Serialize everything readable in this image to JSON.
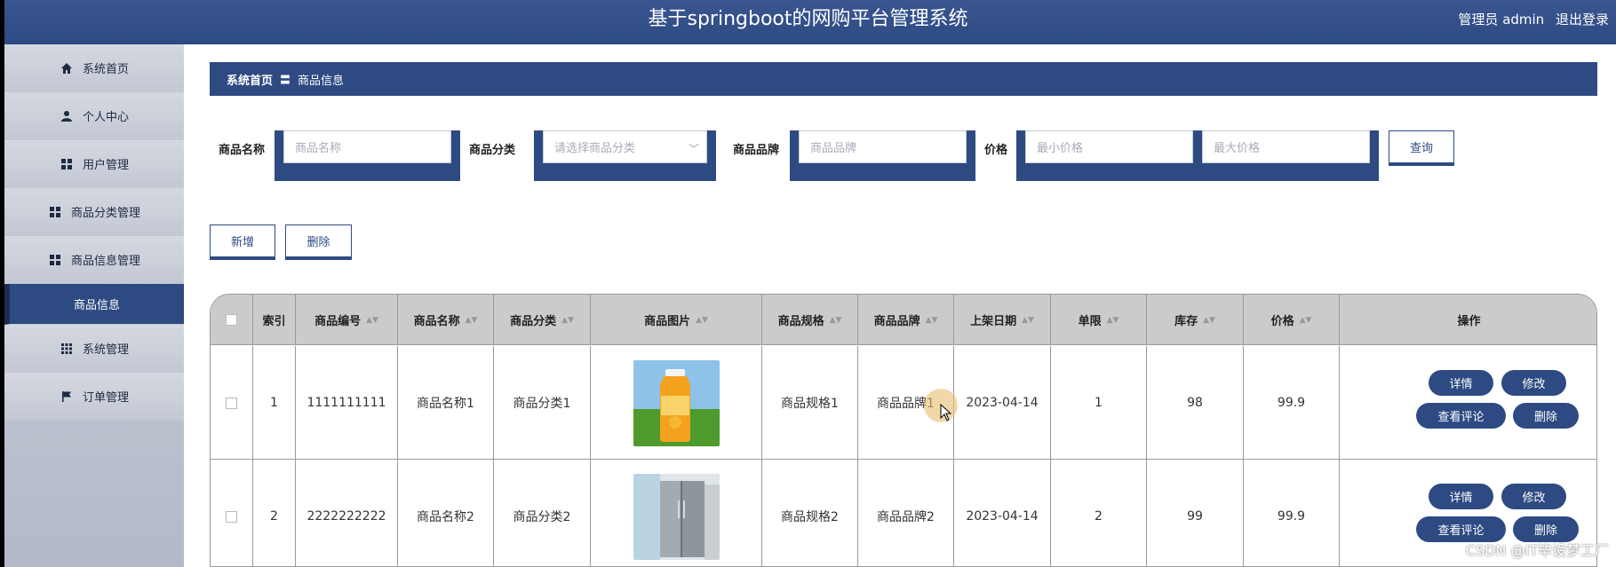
{
  "header": {
    "title": "基于springboot的网购平台管理系统",
    "user_label": "管理员 admin",
    "logout": "退出登录"
  },
  "sidebar": {
    "items": [
      {
        "label": "系统首页",
        "icon": "home-icon"
      },
      {
        "label": "个人中心",
        "icon": "user-icon"
      },
      {
        "label": "用户管理",
        "icon": "grid-icon"
      },
      {
        "label": "商品分类管理",
        "icon": "grid-icon"
      },
      {
        "label": "商品信息管理",
        "icon": "grid-icon"
      },
      {
        "label": "商品信息",
        "icon": "",
        "active": true
      },
      {
        "label": "系统管理",
        "icon": "apps-icon"
      },
      {
        "label": "订单管理",
        "icon": "flag-icon"
      }
    ]
  },
  "breadcrumb": {
    "home": "系统首页",
    "separator": "〓",
    "current": "商品信息"
  },
  "search": {
    "name_label": "商品名称",
    "name_placeholder": "商品名称",
    "category_label": "商品分类",
    "category_placeholder": "请选择商品分类",
    "brand_label": "商品品牌",
    "brand_placeholder": "商品品牌",
    "price_label": "价格",
    "min_price_placeholder": "最小价格",
    "max_price_placeholder": "最大价格",
    "query_button": "查询"
  },
  "actions": {
    "add": "新增",
    "delete": "删除"
  },
  "table": {
    "columns": [
      "",
      "索引",
      "商品编号",
      "商品名称",
      "商品分类",
      "商品图片",
      "商品规格",
      "商品品牌",
      "上架日期",
      "单限",
      "库存",
      "价格",
      "操作"
    ],
    "rows": [
      {
        "index": "1",
        "code": "1111111111",
        "name": "商品名称1",
        "category": "商品分类1",
        "image": "orange-juice-bottle",
        "spec": "商品规格1",
        "brand": "商品品牌1",
        "date": "2023-04-14",
        "limit": "1",
        "stock": "98",
        "price": "99.9"
      },
      {
        "index": "2",
        "code": "2222222222",
        "name": "商品名称2",
        "category": "商品分类2",
        "image": "refrigerator",
        "spec": "商品规格2",
        "brand": "商品品牌2",
        "date": "2023-04-14",
        "limit": "2",
        "stock": "99",
        "price": "99.9"
      }
    ],
    "row_actions": {
      "detail": "详情",
      "edit": "修改",
      "comments": "查看评论",
      "delete": "删除"
    }
  },
  "watermark": "CSDN @IT毕设梦工厂",
  "colors": {
    "primary": "#2d4a82",
    "sidebar_bg": "#c3c8d3",
    "header_gray": "#cbcbcb"
  }
}
